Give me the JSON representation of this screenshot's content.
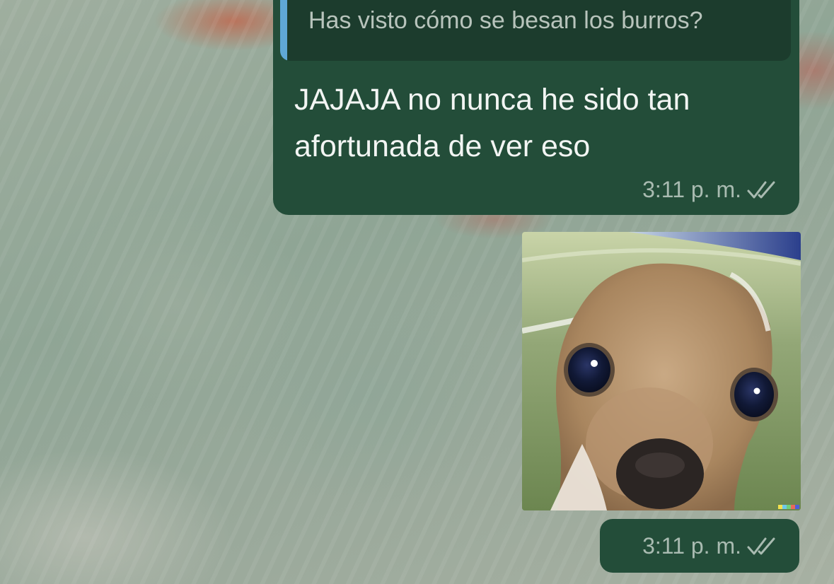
{
  "chat": {
    "messages": [
      {
        "type": "text",
        "quoted_text": "Has visto cómo se besan los burros?",
        "text": "JAJAJA no nunca he sido tan afortunada de ver eso",
        "time": "3:11 p. m.",
        "status_icon": "double-check-icon"
      },
      {
        "type": "image",
        "image_subject": "chihuahua-puppy-photo",
        "time": "3:11 p. m.",
        "status_icon": "double-check-icon"
      }
    ]
  },
  "colors": {
    "bubble_outgoing": "#234d39",
    "quote_background": "#1c3c2d",
    "quote_accent": "#5fa8d6",
    "meta_text": "#a9bbb1"
  }
}
